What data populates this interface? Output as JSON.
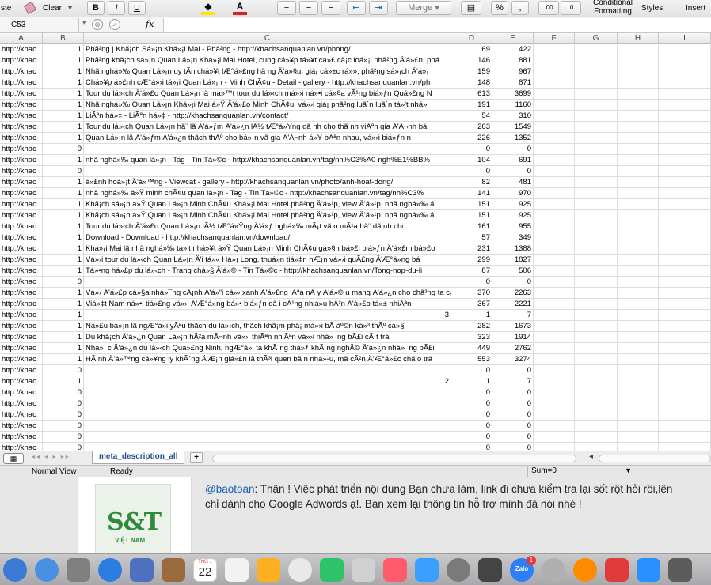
{
  "ribbon": {
    "paste": "ste",
    "clear": "Clear",
    "bold": "B",
    "italic": "I",
    "underline": "U",
    "merge": "Merge",
    "percent": "%",
    "comma": ",",
    "dec_inc": ".00",
    "dec_dec": ".0",
    "conditional": "Conditional",
    "formatting": "Formatting",
    "styles": "Styles",
    "insert": "Insert"
  },
  "formula_bar": {
    "cell_ref": "C53",
    "fx": "fx",
    "cancel": "⊗",
    "confirm": "✓",
    "value": ""
  },
  "columns": [
    "A",
    "B",
    "C",
    "D",
    "E",
    "F",
    "G",
    "H",
    "I"
  ],
  "rows": [
    [
      "http://khac",
      "1",
      "Phã²ng | Khã¡ch Sá»¡n Khá»¡i Mai - Phã²ng - http://khachsanquanlan.vn/phong/",
      "",
      "69",
      "422"
    ],
    [
      "http://khac",
      "1",
      "Phã²ng khã¡ch sá»¡n Quan Lá»¡n Khá»¡i Mai Hotel, cung cá»¥p tá»¥t cá»£ cã¡c loá»¡i phã²ng Ä'á»£n, phá",
      "",
      "146",
      "881"
    ],
    [
      "http://khac",
      "1",
      "Nhã  nghá»‰ Quan Lá»¡n uy tÃ­n chá»¥t lÆ°á»£ng hã ng Ä'á»§u, giá¡ cá»±c rá»», phã²ng sá»¡ch Ä'á»¡",
      "",
      "159",
      "967"
    ],
    [
      "http://khac",
      "1",
      "Chá»¥p á»£nh cÆ°á»›i tá»¡i Quan Lá»¡n - Minh ChÃ¢u - Detail - gallery - http://khachsanquanlan.vn/ph",
      "",
      "148",
      "871"
    ],
    [
      "http://khac",
      "1",
      "Tour du lá»‹ch Ä'á»£o Quan Lá»¡n lã  má»™t tour du lá»‹ch má»›i ná»•i cá»§a vÃ¹ng biá»ƒn Quá»£ng N",
      "",
      "613",
      "3699"
    ],
    [
      "http://khac",
      "1",
      "Nhã  nghá»‰ Quan Lá»¡n Khá»¡i Mai á»Ÿ Ä'á»£o Minh ChÃ¢u, vá»›i giá¡ phã²ng luã´n luã´n tá»'t nhá»",
      "",
      "191",
      "1160"
    ],
    [
      "http://khac",
      "1",
      "LiÃªn há»‡ - LiÃªn há»‡ - http://khachsanquanlan.vn/contact/",
      "",
      "54",
      "310"
    ],
    [
      "http://khac",
      "1",
      "Tour du lá»‹ch Quan Lá»¡n hã¨ lã  Ä'á»ƒm Ä'á»¿n lÃ½ tÆ°á»Ÿng dã nh cho thã nh viÃªn gia Ä'Ã¬nh bá",
      "",
      "263",
      "1549"
    ],
    [
      "http://khac",
      "1",
      "Quan Lá»¡n lã  Ä'á»ƒm Ä'á»¿n thã­ch thÃº cho bá»¡n vã  gia Ä'Ã¬nh á»Ÿ bÃªn nhau, vá»›i biá»ƒn n",
      "",
      "226",
      "1352"
    ],
    [
      "http://khac",
      "0",
      "",
      "",
      "0",
      "0"
    ],
    [
      "http://khac",
      "1",
      "nhã  nghá»‰ quan lá»¡n - Tag - Tin Tá»©c - http://khachsanquanlan.vn/tag/nh%C3%A0-ngh%E1%BB%",
      "",
      "104",
      "691"
    ],
    [
      "http://khac",
      "0",
      "",
      "",
      "0",
      "0"
    ],
    [
      "http://khac",
      "1",
      "á»£nh hoá»¡t Ä'á»™ng - Viewcat - gallery - http://khachsanquanlan.vn/photo/anh-hoat-dong/",
      "",
      "82",
      "481"
    ],
    [
      "http://khac",
      "1",
      "nhã  nghá»‰ á»Ÿ minh chÃ¢u quan lá»¡n - Tag - Tin Tá»©c - http://khachsanquanlan.vn/tag/nh%C3%",
      "",
      "141",
      "970"
    ],
    [
      "http://khac",
      "1",
      "Khã¡ch sá»¡n á»Ÿ Quan Lá»¡n Minh ChÃ¢u Khá»¡i Mai Hotel phã²ng Ä'á»¹p, view Ä'á»¹p, nhã  nghá»‰ á",
      "",
      "151",
      "925"
    ],
    [
      "http://khac",
      "1",
      "Khã¡ch sá»¡n á»Ÿ Quan Lá»¡n Minh ChÃ¢u Khá»¡i Mai Hotel phã²ng Ä'á»¹p, view Ä'á»¹p, nhã  nghá»‰ á",
      "",
      "151",
      "925"
    ],
    [
      "http://khac",
      "1",
      "Tour du lá»‹ch Ä'á»£o Quan Lá»¡n lÃ½ tÆ°á»Ÿng Ä'á»ƒ nghá»‰ mÃ¡t vã  o mÃ¹a hã¨ dã nh cho",
      "",
      "161",
      "955"
    ],
    [
      "http://khac",
      "1",
      "Download - Download - http://khachsanquanlan.vn/download/",
      "",
      "57",
      "349"
    ],
    [
      "http://khac",
      "1",
      "Khá»¡i Mai lã  nhã  nghá»‰ tá»'t nhá»¥t á»Ÿ Quan Lá»¡n Minh ChÃ¢u gá»§n bá»£i biá»ƒn Ä'á»£m bá»£o",
      "",
      "231",
      "1388"
    ],
    [
      "http://khac",
      "1",
      "Vá»›i tour du lá»‹ch Quan Lá»¡n Ä'i tá»« Há»¡ Long, thuá»n tiá»‡n hÆ¡n vá»›i quÃ£ng Ä'Æ°á»ng bá",
      "",
      "299",
      "1827"
    ],
    [
      "http://khac",
      "1",
      "Tá»•ng há»£p du lá»‹ch - Trang chá»§ Ä'á»© - Tin Tá»©c - http://khachsanquanlan.vn/Tong-hop-du-li",
      "",
      "87",
      "506"
    ],
    [
      "http://khac",
      "0",
      "",
      "",
      "0",
      "0"
    ],
    [
      "http://khac",
      "1",
      "Vá»› Ä'á»£p cá»§a nhá»¯ng cÃ¡nh Ä'á»“i cá»› xanh Ä'á»£ng lÃªa nÃ y Ä'á»© u mang Ä'á»¿n cho chã³ng ta cá»£m giã¡c th",
      "",
      "370",
      "2263"
    ],
    [
      "http://khac",
      "1",
      "Viá»‡t Nam ná»•i tiá»£ng vá»›i Ä'Æ°á»ng bá»• biá»ƒn dã i cÃ¹ng nhiá»u hÃ²n Ä'á»£o tá»± nhiÃªn",
      "",
      "367",
      "2221"
    ],
    [
      "http://khac",
      "1",
      "",
      "3",
      "1",
      "7"
    ],
    [
      "http://khac",
      "1",
      "Ná»£u bá»¡n lã  ngÆ°á»i yÃªu thã­ch du lá»‹ch, thã­ch khã¡m phã¡ má»›i bÃ­ áº©n ká»³ thÃº cá»§",
      "",
      "282",
      "1673"
    ],
    [
      "http://khac",
      "1",
      "Du khã¡ch Ä'á»¿n Quan Lá»¡n hÃ²a mÃ¬nh vá»›i thiÃªn nhiÃªn vá»›i nhá»¯ng bÃ£i cÃ¡t trá",
      "",
      "323",
      "1914"
    ],
    [
      "http://khac",
      "1",
      "Nhá»¯c Ä'á»¿n du lá»‹ch Quá»£ng Ninh, ngÆ°á»i ta khÃ´ng thá»ƒ khÃ´ng nghÄ© Ä'á»¿n nhá»¯ng bÃ£i",
      "",
      "449",
      "2762"
    ],
    [
      "http://khac",
      "1",
      "HÃ nh Ä'á»™ng cá»¥ng ly khÃ´ng Ä'Æ¡n giá»£n lã  thÃ³i quen bã n nhá»-u, mã  cÃ²n Ä'Æ°á»£c chã o trá",
      "",
      "553",
      "3274"
    ],
    [
      "http://khac",
      "0",
      "",
      "",
      "0",
      "0"
    ],
    [
      "http://khac",
      "1",
      "",
      "2",
      "1",
      "7"
    ],
    [
      "http://khac",
      "0",
      "",
      "",
      "0",
      "0"
    ],
    [
      "http://khac",
      "0",
      "",
      "",
      "0",
      "0"
    ],
    [
      "http://khac",
      "0",
      "",
      "",
      "0",
      "0"
    ],
    [
      "http://khac",
      "0",
      "",
      "",
      "0",
      "0"
    ],
    [
      "http://khac",
      "0",
      "",
      "",
      "0",
      "0"
    ],
    [
      "http://khac",
      "0",
      "",
      "",
      "0",
      "0"
    ],
    [
      "http://khac",
      "0",
      "",
      "",
      "0",
      "0"
    ]
  ],
  "sheet_tab": "meta_description_all",
  "add_sheet": "+",
  "status": {
    "view": "Normal View",
    "state": "Ready",
    "sum": "Sum=0"
  },
  "chat": {
    "mention": "@baotoan",
    "message": ": Thân ! Việc phát triển nội dung Bạn chưa làm, link đi chưa kiểm tra lại sốt rột hỏi rồi,lên",
    "message2": "chỉ dành cho Google Adwords ạ!. Bạn xem lại thông tin hỗ trợ mình đã nói nhé !",
    "logo": "S&T",
    "logo_sub": "VIỆT NAM"
  },
  "dock": {
    "calendar_month": "THG 1",
    "calendar_day": "22",
    "zalo": "Zalo",
    "badge": "1"
  },
  "colors": {
    "accent": "#1a5fb4",
    "logo_green": "#2e8b3a",
    "logo_red": "#cc2222",
    "font_red": "#e02020",
    "highlight_yellow": "#ffe600"
  }
}
